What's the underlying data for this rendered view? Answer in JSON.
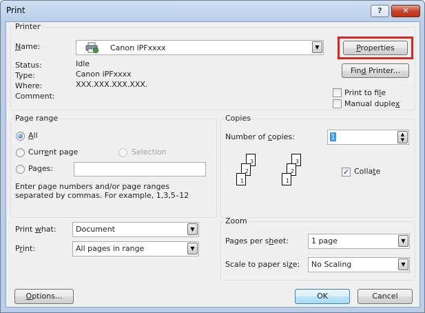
{
  "window": {
    "title": "Print"
  },
  "printer": {
    "group_label": "Printer",
    "name_label": "Name:",
    "name_value": "Canon iPFxxxx",
    "status_label": "Status:",
    "status_value": "Idle",
    "type_label": "Type:",
    "type_value": "Canon iPFxxxx",
    "where_label": "Where:",
    "where_value": "XXX.XXX.XXX.XXX.",
    "comment_label": "Comment:",
    "properties_button": "Properties",
    "find_printer_button": "Find Printer...",
    "print_to_file": "Print to file",
    "manual_duplex": "Manual duplex",
    "print_to_file_checked": false,
    "manual_duplex_checked": false
  },
  "page_range": {
    "group_label": "Page range",
    "all": "All",
    "current_page": "Current page",
    "selection": "Selection",
    "pages": "Pages:",
    "pages_value": "",
    "selected": "All",
    "help_line1": "Enter page numbers and/or page ranges",
    "help_line2": "separated by commas.  For example, 1,3,5–12"
  },
  "copies": {
    "group_label": "Copies",
    "number_label": "Number of copies:",
    "number_value": "1",
    "collate": "Collate",
    "collate_checked": true,
    "set1": [
      "3",
      "2",
      "1"
    ],
    "set2": [
      "3",
      "2",
      "1"
    ]
  },
  "print_what": {
    "label": "Print what:",
    "value": "Document"
  },
  "print": {
    "label": "Print:",
    "value": "All pages in range"
  },
  "zoom": {
    "group_label": "Zoom",
    "pages_per_sheet_label": "Pages per sheet:",
    "pages_per_sheet_value": "1 page",
    "scale_label": "Scale to paper size:",
    "scale_value": "No Scaling"
  },
  "buttons": {
    "options": "Options...",
    "ok": "OK",
    "cancel": "Cancel"
  },
  "icons": {
    "help": "question-mark-icon",
    "close": "close-x-icon",
    "printer": "printer-icon",
    "dropdown": "chevron-down-icon",
    "spin": "spin-up-down-icon"
  },
  "colors": {
    "highlight": "#e8201c",
    "title_bar": "#b9cfe9",
    "client": "#f0f0f0"
  }
}
